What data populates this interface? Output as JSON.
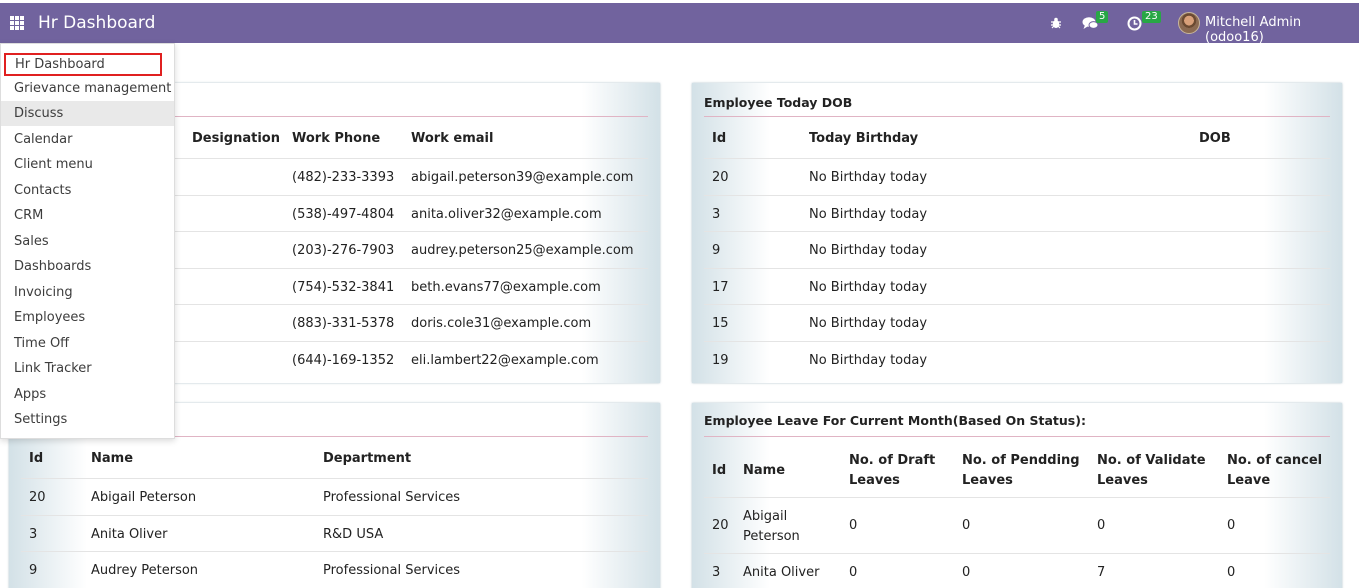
{
  "topbar": {
    "app_title": "Hr Dashboard",
    "apps_icon": "grid-icon",
    "messages_badge": "5",
    "activities_badge": "23",
    "user_name": "Mitchell Admin (odoo16)",
    "background_color": "#71639e",
    "badge_color": "#28a745"
  },
  "menu": {
    "items": [
      {
        "label": "Hr Dashboard"
      },
      {
        "label": "Grievance management"
      },
      {
        "label": "Discuss"
      },
      {
        "label": "Calendar"
      },
      {
        "label": "Client menu"
      },
      {
        "label": "Contacts"
      },
      {
        "label": "CRM"
      },
      {
        "label": "Sales"
      },
      {
        "label": "Dashboards"
      },
      {
        "label": "Invoicing"
      },
      {
        "label": "Employees"
      },
      {
        "label": "Time Off"
      },
      {
        "label": "Link Tracker"
      },
      {
        "label": "Apps"
      },
      {
        "label": "Settings"
      }
    ]
  },
  "contacts_table": {
    "headers": {
      "designation": "Designation",
      "work_phone": "Work Phone",
      "work_email": "Work email"
    },
    "rows": [
      {
        "phone": "(482)-233-3393",
        "email": "abigail.peterson39@example.com"
      },
      {
        "phone": "(538)-497-4804",
        "email": "anita.oliver32@example.com"
      },
      {
        "phone": "(203)-276-7903",
        "email": "audrey.peterson25@example.com"
      },
      {
        "phone": "(754)-532-3841",
        "email": "beth.evans77@example.com"
      },
      {
        "phone": "(883)-331-5378",
        "email": "doris.cole31@example.com"
      },
      {
        "phone": "(644)-169-1352",
        "email": "eli.lambert22@example.com"
      }
    ]
  },
  "dob_table": {
    "title": "Employee Today DOB",
    "headers": {
      "id": "Id",
      "today_birthday": "Today Birthday",
      "dob": "DOB"
    },
    "rows": [
      {
        "id": "20",
        "birthday": "No Birthday today"
      },
      {
        "id": "3",
        "birthday": "No Birthday today"
      },
      {
        "id": "9",
        "birthday": "No Birthday today"
      },
      {
        "id": "17",
        "birthday": "No Birthday today"
      },
      {
        "id": "15",
        "birthday": "No Birthday today"
      },
      {
        "id": "19",
        "birthday": "No Birthday today"
      }
    ]
  },
  "department_table": {
    "headers": {
      "id": "Id",
      "name": "Name",
      "department": "Department"
    },
    "rows": [
      {
        "id": "20",
        "name": "Abigail Peterson",
        "department": "Professional Services"
      },
      {
        "id": "3",
        "name": "Anita Oliver",
        "department": "R&D USA"
      },
      {
        "id": "9",
        "name": "Audrey Peterson",
        "department": "Professional Services"
      }
    ]
  },
  "leave_table": {
    "title": "Employee Leave For Current Month(Based On Status):",
    "headers": {
      "id": "Id",
      "name": "Name",
      "draft_1": "No. of Draft",
      "draft_2": "Leaves",
      "pending_1": "No. of Pendding",
      "pending_2": "Leaves",
      "validate_1": "No. of Validate",
      "validate_2": "Leaves",
      "cancel_1": "No. of cancel",
      "cancel_2": "Leave"
    },
    "rows": [
      {
        "id": "20",
        "name_1": "Abigail",
        "name_2": "Peterson",
        "draft": "0",
        "pending": "0",
        "validate": "0",
        "cancel": "0"
      },
      {
        "id": "3",
        "name_1": "Anita Oliver",
        "name_2": "",
        "draft": "0",
        "pending": "0",
        "validate": "7",
        "cancel": "0"
      }
    ]
  }
}
